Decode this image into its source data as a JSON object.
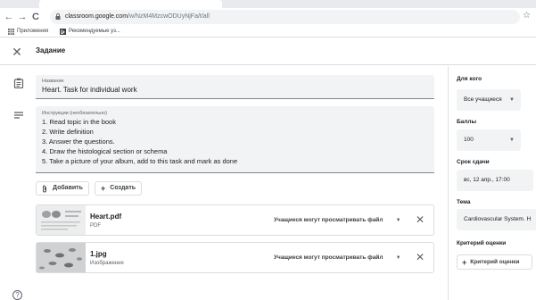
{
  "browser": {
    "back_glyph": "←",
    "forward_glyph": "→",
    "reload_glyph": "C",
    "url_host": "classroom.google.com",
    "url_path": "/w/NzM4MzcwODUyNjFa/t/all",
    "star_glyph": "☆"
  },
  "bookmarks": {
    "apps_label": "Приложения",
    "recommended_label": "Рекомендуемые уз..."
  },
  "header": {
    "close_glyph": "✕",
    "title": "Задание"
  },
  "main": {
    "title_field": {
      "label": "Название",
      "value": "Heart. Task for individual work"
    },
    "instructions_field": {
      "label": "Инструкции (необязательно)",
      "lines": [
        "1. Read topic in the book",
        "2. Write definition",
        "3. Answer the questions.",
        "4. Draw the histological section or schema",
        "5. Take a picture of your album, add to this task and mark as done"
      ]
    },
    "add_button": "Добавить",
    "create_button": "Создать",
    "attachments": [
      {
        "name": "Heart.pdf",
        "type": "PDF",
        "permission": "Учащиеся могут просматривать файл"
      },
      {
        "name": "1.jpg",
        "type": "Изображение",
        "permission": "Учащиеся могут просматривать файл"
      }
    ]
  },
  "sidebar": {
    "for_whom_label": "Для кого",
    "for_whom_value": "Все учащиеся",
    "points_label": "Баллы",
    "points_value": "100",
    "due_label": "Срок сдачи",
    "due_value": "вс, 12 апр., 17:00",
    "topic_label": "Тема",
    "topic_value": "Cardiovascular System. H",
    "rubric_label": "Критерий оценки",
    "rubric_button": "Критерий оценки"
  },
  "help_glyph": "?"
}
